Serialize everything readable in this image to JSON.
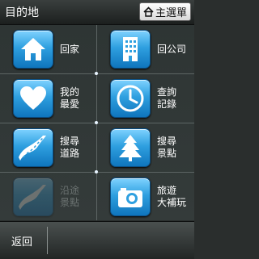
{
  "header": {
    "title": "目的地",
    "menu_label": "主選單"
  },
  "grid": {
    "items": [
      {
        "label": "回家",
        "icon": "home-icon",
        "enabled": true
      },
      {
        "label": "回公司",
        "icon": "office-building-icon",
        "enabled": true
      },
      {
        "label": "我的\n最愛",
        "icon": "heart-icon",
        "enabled": true
      },
      {
        "label": "查詢\n記錄",
        "icon": "clock-icon",
        "enabled": true
      },
      {
        "label": "搜尋\n道路",
        "icon": "road-icon",
        "enabled": true
      },
      {
        "label": "搜尋\n景點",
        "icon": "tree-icon",
        "enabled": true
      },
      {
        "label": "沿途\n景點",
        "icon": "route-road-icon",
        "enabled": false
      },
      {
        "label": "旅遊\n大補玩",
        "icon": "camera-icon",
        "enabled": true
      }
    ]
  },
  "footer": {
    "back_label": "返回"
  },
  "colors": {
    "tile_blue": "#2fa0e0",
    "background": "#2e3534"
  }
}
